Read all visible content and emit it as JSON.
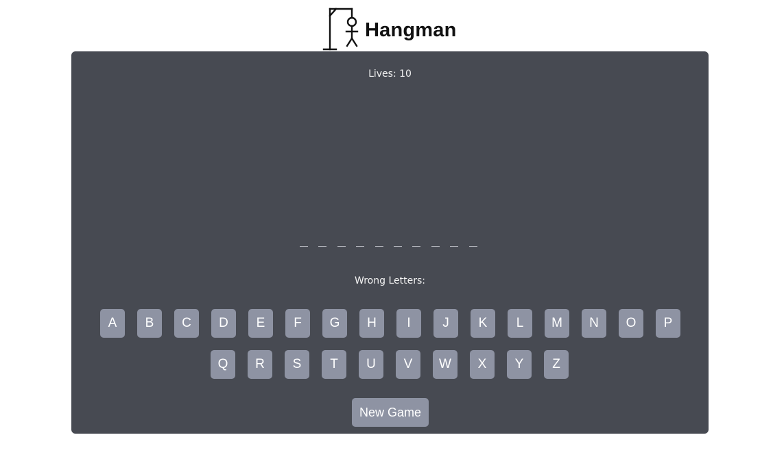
{
  "header": {
    "title": "Hangman",
    "logo_icon": "gallows-stickman-icon"
  },
  "game": {
    "lives_label": "Lives: 10",
    "word_length": 10,
    "wrong_letters_label": "Wrong Letters:",
    "keyboard_row_1": [
      "A",
      "B",
      "C",
      "D",
      "E",
      "F",
      "G",
      "H",
      "I",
      "J",
      "K",
      "L",
      "M",
      "N",
      "O",
      "P"
    ],
    "keyboard_row_2": [
      "Q",
      "R",
      "S",
      "T",
      "U",
      "V",
      "W",
      "X",
      "Y",
      "Z"
    ],
    "new_game_label": "New Game"
  },
  "colors": {
    "panel_bg": "#474a52",
    "key_bg": "#8e93a3",
    "key_text": "#ffffff"
  }
}
